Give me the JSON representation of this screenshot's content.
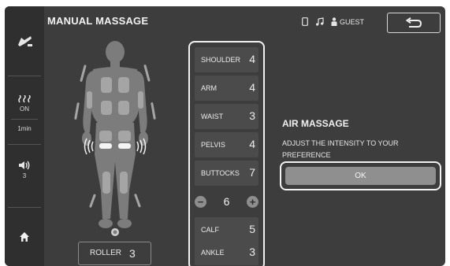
{
  "header": {
    "title": "MANUAL MASSAGE",
    "user_label": "GUEST"
  },
  "sidebar": {
    "heat_status": "ON",
    "timer": "1min",
    "volume_level": "3",
    "icons": [
      "chair-recline-icon",
      "heat-icon",
      "volume-icon",
      "home-icon"
    ]
  },
  "roller": {
    "label": "ROLLER",
    "value": "3"
  },
  "intensity_list": {
    "items": [
      {
        "label": "SHOULDER",
        "value": "4"
      },
      {
        "label": "ARM",
        "value": "4"
      },
      {
        "label": "WAIST",
        "value": "3"
      },
      {
        "label": "PELVIS",
        "value": "4"
      },
      {
        "label": "BUTTOCKS",
        "value": "7"
      }
    ],
    "stepper": {
      "minus": "−",
      "value": "6",
      "plus": "+"
    },
    "items_lower": [
      {
        "label": "CALF",
        "value": "5"
      },
      {
        "label": "ANKLE",
        "value": "3"
      }
    ]
  },
  "air_massage": {
    "title": "AIR MASSAGE",
    "description": "ADJUST THE INTENSITY TO YOUR PREFERENCE",
    "ok_label": "OK"
  },
  "colors": {
    "background": "#3d3d3d",
    "sidebar": "#2f2f2f",
    "row": "#4b4b4b",
    "button": "#8f8f8f"
  }
}
